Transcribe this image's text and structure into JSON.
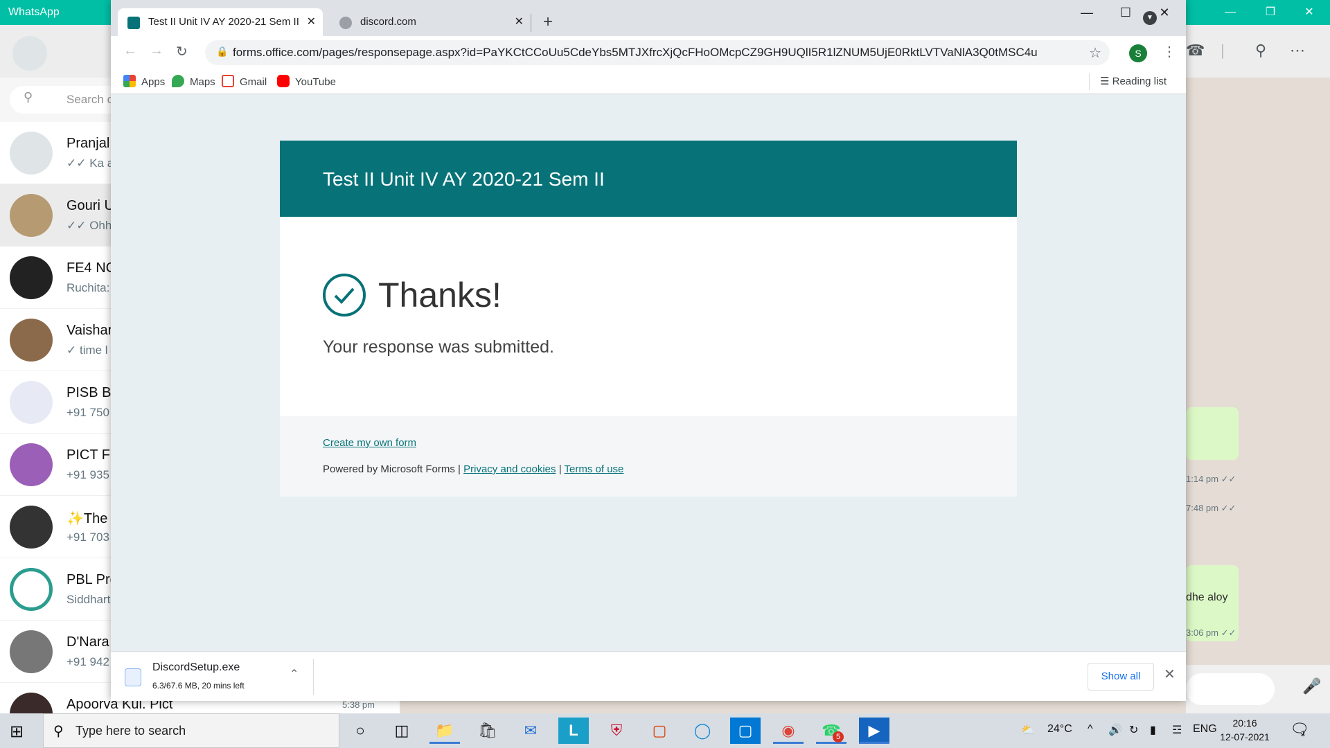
{
  "whatsapp": {
    "title": "WhatsApp",
    "search_placeholder": "Search c",
    "chats": [
      {
        "name": "Pranjal",
        "msg": "✓✓ Ka aa"
      },
      {
        "name": "Gouri U",
        "msg": "✓✓ Ohhk"
      },
      {
        "name": "FE4 NC",
        "msg": "Ruchita:"
      },
      {
        "name": "Vaishar",
        "msg": "✓ time l"
      },
      {
        "name": "PISB B",
        "msg": "+91 750"
      },
      {
        "name": "PICT FI",
        "msg": "+91 935"
      },
      {
        "name": "✨The",
        "msg": "+91 703"
      },
      {
        "name": "PBL Pro",
        "msg": "Siddhart"
      },
      {
        "name": "D'Nara",
        "msg": "+91 942"
      },
      {
        "name": "Apoorva Kul. Pict",
        "msg": "5:38 pm"
      }
    ],
    "timestamps": [
      "1:14 pm ✓✓",
      "7:48 pm ✓✓",
      "3:06 pm ✓✓"
    ],
    "bubble_text": "dhe aloy"
  },
  "browser": {
    "tabs": [
      {
        "title": "Test II Unit IV AY 2020-21 Sem II"
      },
      {
        "title": "discord.com"
      }
    ],
    "url": "forms.office.com/pages/responsepage.aspx?id=PaYKCtCCoUu5CdeYbs5MTJXfrcXjQcFHoOMcpCZ9GH9UQlI5R1lZNUM5UjE0RktLVTVaNlA3Q0tMSC4u",
    "profile_initial": "S",
    "bookmarks": [
      "Apps",
      "Maps",
      "Gmail",
      "YouTube"
    ],
    "reading_list": "Reading list"
  },
  "form": {
    "title": "Test II Unit IV AY 2020-21 Sem II",
    "thanks": "Thanks!",
    "submitted": "Your response was submitted.",
    "create_link": "Create my own form",
    "powered_by": "Powered by Microsoft Forms |",
    "privacy": "Privacy and cookies",
    "sep": "|",
    "terms": "Terms of use"
  },
  "download": {
    "filename": "DiscordSetup.exe",
    "status": "6.3/67.6 MB, 20 mins left",
    "show_all": "Show all"
  },
  "taskbar": {
    "search_placeholder": "Type here to search",
    "weather": "24°C",
    "lang": "ENG",
    "time": "20:16",
    "date": "12-07-2021",
    "whatsapp_badge": "5",
    "notif_count": "2"
  },
  "colors": {
    "forms_teal": "#077378",
    "whatsapp_green": "#00bfa5",
    "link_blue": "#1a73e8"
  }
}
